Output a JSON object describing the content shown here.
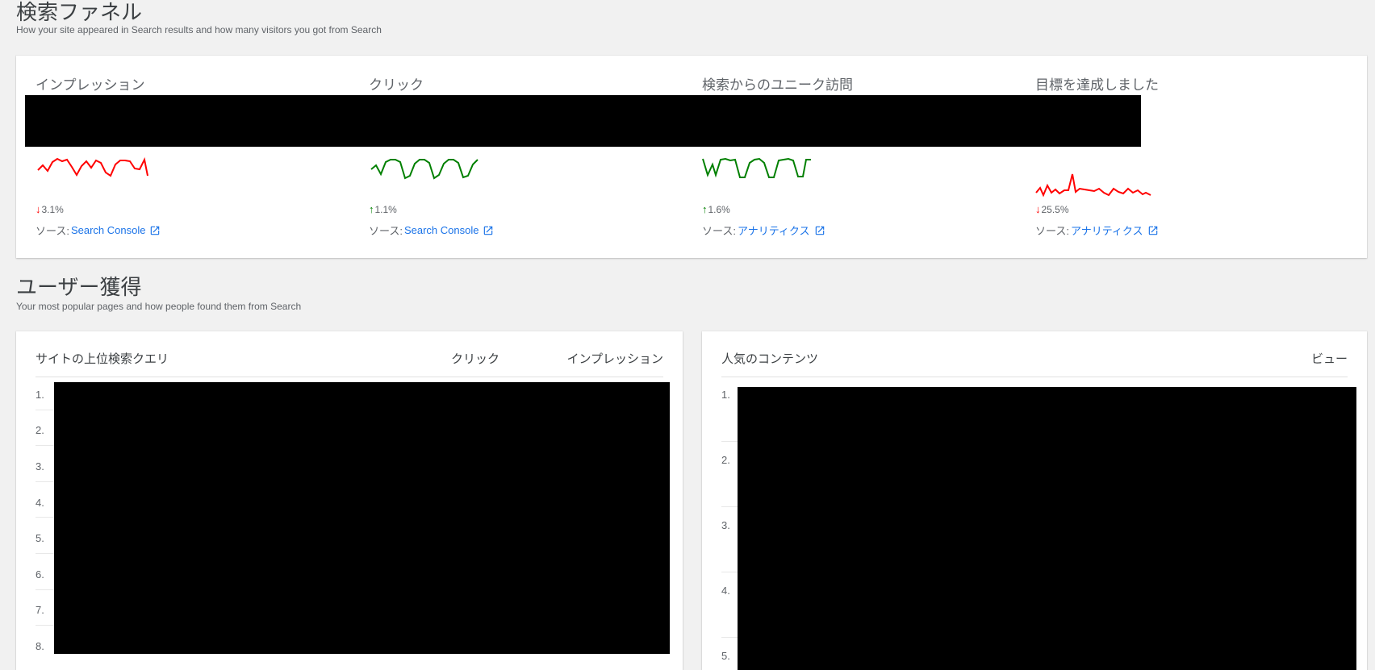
{
  "funnel": {
    "title": "検索ファネル",
    "subtitle": "How your site appeared in Search results and how many visitors you got from Search",
    "metrics": [
      {
        "label": "インプレッション",
        "change": "3.1%",
        "direction": "down",
        "source_prefix": "ソース:",
        "source_link": "Search Console",
        "color": "#ff0000"
      },
      {
        "label": "クリック",
        "change": "1.1%",
        "direction": "up",
        "source_prefix": "ソース:",
        "source_link": "Search Console",
        "color": "#008000"
      },
      {
        "label": "検索からのユニーク訪問",
        "change": "1.6%",
        "direction": "up",
        "source_prefix": "ソース:",
        "source_link": "アナリティクス",
        "color": "#008000"
      },
      {
        "label": "目標を達成しました",
        "change": "25.5%",
        "direction": "down",
        "source_prefix": "ソース:",
        "source_link": "アナリティクス",
        "color": "#ff0000"
      }
    ]
  },
  "acquisition": {
    "title": "ユーザー獲得",
    "subtitle": "Your most popular pages and how people found them from Search",
    "queries": {
      "col_query": "サイトの上位検索クエリ",
      "col_clicks": "クリック",
      "col_impressions": "インプレッション",
      "rows": [
        "1.",
        "2.",
        "3.",
        "4.",
        "5.",
        "6.",
        "7.",
        "8."
      ]
    },
    "content": {
      "col_content": "人気のコンテンツ",
      "col_views": "ビュー",
      "rows": [
        "1.",
        "2.",
        "3.",
        "4.",
        "5."
      ]
    }
  },
  "icons": {
    "arrow_up": "↑",
    "arrow_down": "↓",
    "external_link": "open-in-new-icon"
  }
}
